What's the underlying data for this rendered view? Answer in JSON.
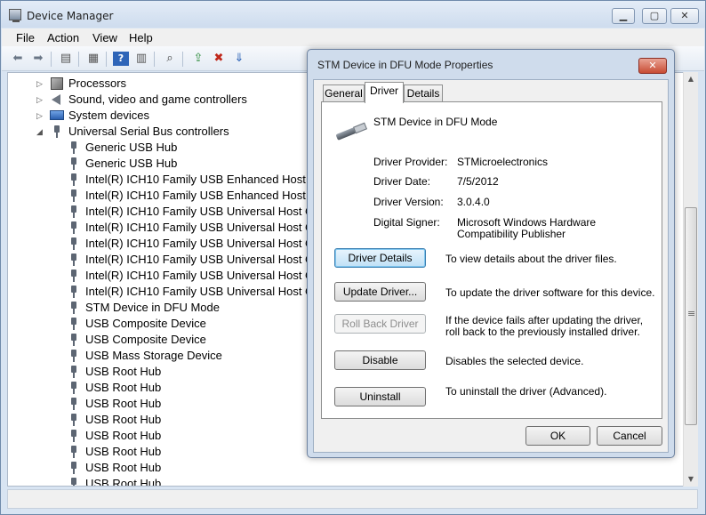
{
  "window": {
    "title": "Device Manager"
  },
  "menu": [
    "File",
    "Action",
    "View",
    "Help"
  ],
  "toolbar": {
    "icons": [
      "back-arrow-icon",
      "forward-arrow-icon",
      "show-hide-tree-icon",
      "properties-icon",
      "help-icon",
      "console-tree-icon",
      "scan-hardware-icon",
      "update-driver-icon",
      "disable-device-icon",
      "uninstall-device-icon"
    ]
  },
  "tree": {
    "categories": [
      {
        "label": "Processors",
        "icon": "processor-icon",
        "expander": "▷"
      },
      {
        "label": "Sound, video and game controllers",
        "icon": "sound-icon",
        "expander": "▷"
      },
      {
        "label": "System devices",
        "icon": "computer-icon",
        "expander": "▷"
      },
      {
        "label": "Universal Serial Bus controllers",
        "icon": "usb-icon",
        "expander": "◢"
      }
    ],
    "usb_children": [
      "Generic USB Hub",
      "Generic USB Hub",
      "Intel(R) ICH10 Family USB Enhanced Host Contro",
      "Intel(R) ICH10 Family USB Enhanced Host Contro",
      "Intel(R) ICH10 Family USB Universal Host Contro",
      "Intel(R) ICH10 Family USB Universal Host Contro",
      "Intel(R) ICH10 Family USB Universal Host Contro",
      "Intel(R) ICH10 Family USB Universal Host Contro",
      "Intel(R) ICH10 Family USB Universal Host Contro",
      "Intel(R) ICH10 Family USB Universal Host Contro",
      "STM Device in DFU Mode",
      "USB Composite Device",
      "USB Composite Device",
      "USB Mass Storage Device",
      "USB Root Hub",
      "USB Root Hub",
      "USB Root Hub",
      "USB Root Hub",
      "USB Root Hub",
      "USB Root Hub",
      "USB Root Hub",
      "USB Root Hub"
    ]
  },
  "dialog": {
    "title": "STM Device in DFU Mode Properties",
    "close_glyph": "✕",
    "tabs": [
      {
        "label": "General",
        "active": false
      },
      {
        "label": "Driver",
        "active": true
      },
      {
        "label": "Details",
        "active": false
      }
    ],
    "device_name": "STM Device in DFU Mode",
    "fields": [
      {
        "label": "Driver Provider:",
        "value": "STMicroelectronics"
      },
      {
        "label": "Driver Date:",
        "value": "7/5/2012"
      },
      {
        "label": "Driver Version:",
        "value": "3.0.4.0"
      },
      {
        "label": "Digital Signer:",
        "value": "Microsoft Windows Hardware Compatibility Publisher"
      }
    ],
    "actions": [
      {
        "button": "Driver Details",
        "description": "To view details about the driver files.",
        "enabled": true,
        "focused": true
      },
      {
        "button": "Update Driver...",
        "description": "To update the driver software for this device.",
        "enabled": true,
        "focused": false
      },
      {
        "button": "Roll Back Driver",
        "description": "If the device fails after updating the driver, roll back to the previously installed driver.",
        "enabled": false,
        "focused": false
      },
      {
        "button": "Disable",
        "description": "Disables the selected device.",
        "enabled": true,
        "focused": false
      },
      {
        "button": "Uninstall",
        "description": "To uninstall the driver (Advanced).",
        "enabled": true,
        "focused": false
      }
    ],
    "ok_label": "OK",
    "cancel_label": "Cancel"
  }
}
